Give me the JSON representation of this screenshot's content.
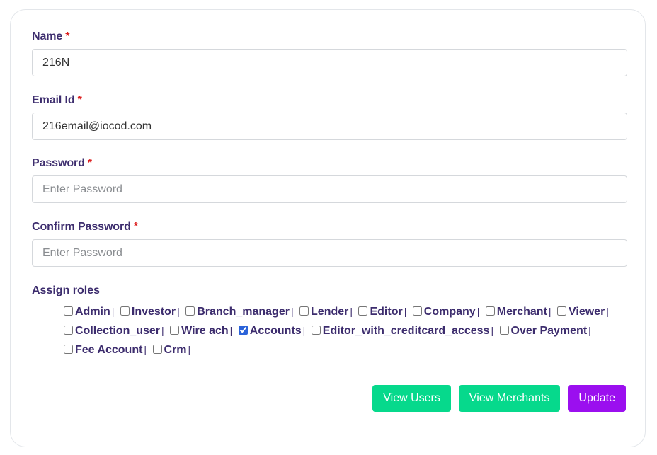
{
  "form": {
    "name": {
      "label": "Name",
      "required_mark": "*",
      "value": "216N",
      "placeholder": ""
    },
    "email": {
      "label": "Email Id",
      "required_mark": "*",
      "value": "216email@iocod.com",
      "placeholder": ""
    },
    "password": {
      "label": "Password",
      "required_mark": "*",
      "value": "",
      "placeholder": "Enter Password"
    },
    "confirm_password": {
      "label": "Confirm Password",
      "required_mark": "*",
      "value": "",
      "placeholder": "Enter Password"
    },
    "roles": {
      "label": "Assign roles",
      "separator": "|",
      "items": [
        {
          "label": "Admin",
          "checked": false
        },
        {
          "label": "Investor",
          "checked": false
        },
        {
          "label": "Branch_manager",
          "checked": false
        },
        {
          "label": "Lender",
          "checked": false
        },
        {
          "label": "Editor",
          "checked": false
        },
        {
          "label": "Company",
          "checked": false
        },
        {
          "label": "Merchant",
          "checked": false
        },
        {
          "label": "Viewer",
          "checked": false
        },
        {
          "label": "Collection_user",
          "checked": false
        },
        {
          "label": "Wire ach",
          "checked": false
        },
        {
          "label": "Accounts",
          "checked": true
        },
        {
          "label": "Editor_with_creditcard_access",
          "checked": false
        },
        {
          "label": "Over Payment",
          "checked": false
        },
        {
          "label": "Fee Account",
          "checked": false
        },
        {
          "label": "Crm",
          "checked": false
        }
      ]
    }
  },
  "buttons": {
    "view_users": "View Users",
    "view_merchants": "View Merchants",
    "update": "Update"
  },
  "colors": {
    "label": "#3d2d6e",
    "required": "#dc1f1f",
    "green_button": "#06d98c",
    "purple_button": "#9b0fef"
  }
}
